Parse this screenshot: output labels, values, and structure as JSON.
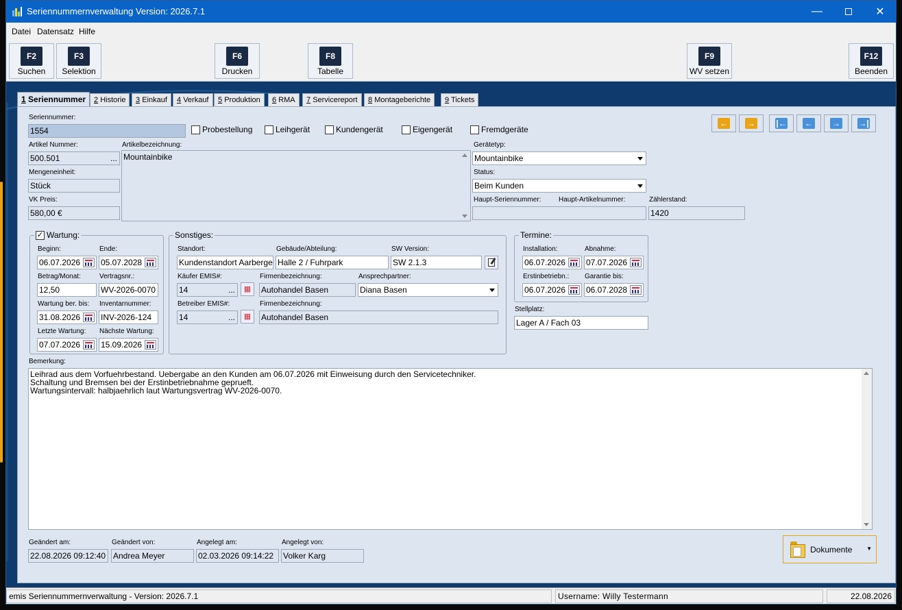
{
  "window": {
    "title": "Seriennummernverwaltung Version: 2026.7.1"
  },
  "menu": {
    "items": [
      "Datei",
      "Datensatz",
      "Hilfe"
    ]
  },
  "toolbar": {
    "f2": {
      "key": "F2",
      "label": "Suchen"
    },
    "f3": {
      "key": "F3",
      "label": "Selektion"
    },
    "f6": {
      "key": "F6",
      "label": "Drucken"
    },
    "f8": {
      "key": "F8",
      "label": "Tabelle"
    },
    "f9": {
      "key": "F9",
      "label": "WV setzen"
    },
    "f12": {
      "key": "F12",
      "label": "Beenden"
    }
  },
  "tabs": [
    {
      "num": "1",
      "label": "Seriennummer"
    },
    {
      "num": "2",
      "label": "Historie"
    },
    {
      "num": "3",
      "label": "Einkauf"
    },
    {
      "num": "4",
      "label": "Verkauf"
    },
    {
      "num": "5",
      "label": "Produktion"
    },
    {
      "num": "6",
      "label": "RMA"
    },
    {
      "num": "7",
      "label": "Servicereport"
    },
    {
      "num": "8",
      "label": "Montageberichte"
    },
    {
      "num": "9",
      "label": "Tickets"
    }
  ],
  "main": {
    "seriennummer": {
      "label": "Seriennummer:",
      "value": "1554"
    },
    "checks": {
      "probestellung": "Probestellung",
      "leihgeraet": "Leihgerät",
      "kundengeraet": "Kundengerät",
      "eigengeraet": "Eigengerät",
      "fremdgeraete": "Fremdgeräte"
    },
    "artikelnummer": {
      "label": "Artikel Nummer:",
      "value": "500.501"
    },
    "artikelbez": {
      "label": "Artikelbezeichnung:",
      "value": "Mountainbike"
    },
    "mengeneinheit": {
      "label": "Mengeneinheit:",
      "value": "Stück"
    },
    "vkpreis": {
      "label": "VK Preis:",
      "value": "580,00 €"
    },
    "geraetetyp": {
      "label": "Gerätetyp:",
      "value": "Mountainbike"
    },
    "status": {
      "label": "Status:",
      "value": "Beim Kunden"
    },
    "hauptsn": {
      "label": "Haupt-Seriennummer:",
      "value": ""
    },
    "hauptart": {
      "label": "Haupt-Artikelnummer:",
      "value": ""
    },
    "zaehler": {
      "label": "Zählerstand:",
      "value": "1420"
    }
  },
  "wartung": {
    "title": "Wartung:",
    "beginn": {
      "label": "Beginn:",
      "value": "06.07.2026"
    },
    "ende": {
      "label": "Ende:",
      "value": "05.07.2028"
    },
    "betrag": {
      "label": "Betrag/Monat:",
      "value": "12,50"
    },
    "vertrag": {
      "label": "Vertragsnr.:",
      "value": "WV-2026-0070"
    },
    "berbis": {
      "label": "Wartung ber. bis:",
      "value": "31.08.2026"
    },
    "inventar": {
      "label": "Inventarnummer:",
      "value": "INV-2026-124"
    },
    "letzte": {
      "label": "Letzte Wartung:",
      "value": "07.07.2026"
    },
    "naechste": {
      "label": "Nächste Wartung:",
      "value": "15.09.2026"
    }
  },
  "sonstiges": {
    "title": "Sonstiges:",
    "standort": {
      "label": "Standort:",
      "value": "Kundenstandort Aarbergen"
    },
    "gebaeude": {
      "label": "Gebäude/Abteilung:",
      "value": "Halle 2 / Fuhrpark"
    },
    "sw": {
      "label": "SW Version:",
      "value": "SW 2.1.3"
    },
    "kaeufer": {
      "label": "Käufer EMIS#:",
      "value": "14"
    },
    "firma1": {
      "label": "Firmenbezeichnung:",
      "value": "Autohandel Basen"
    },
    "ansprech": {
      "label": "Ansprechpartner:",
      "value": "Diana Basen"
    },
    "betreiber": {
      "label": "Betreiber EMIS#:",
      "value": "14"
    },
    "firma2": {
      "label": "Firmenbezeichnung:",
      "value": "Autohandel Basen"
    }
  },
  "termine": {
    "title": "Termine:",
    "installation": {
      "label": "Installation:",
      "value": "06.07.2026"
    },
    "abnahme": {
      "label": "Abnahme:",
      "value": "07.07.2026"
    },
    "erstinbetrieb": {
      "label": "Erstinbetriebn.:",
      "value": "06.07.2026"
    },
    "garantie": {
      "label": "Garantie bis:",
      "value": "06.07.2028"
    }
  },
  "stellplatz": {
    "label": "Stellplatz:",
    "value": "Lager A / Fach 03"
  },
  "bemerkung": {
    "label": "Bemerkung:",
    "value": "Leihrad aus dem Vorfuehrbestand. Uebergabe an den Kunden am 06.07.2026 mit Einweisung durch den Servicetechniker.\nSchaltung und Bremsen bei der Erstinbetriebnahme geprueft.\nWartungsintervall: halbjaehrlich laut Wartungsvertrag WV-2026-0070."
  },
  "footer": {
    "geaendert_am": {
      "label": "Geändert am:",
      "value": "22.08.2026 09:12:40"
    },
    "geaendert_von": {
      "label": "Geändert von:",
      "value": "Andrea Meyer"
    },
    "angelegt_am": {
      "label": "Angelegt am:",
      "value": "02.03.2026 09:14:22"
    },
    "angelegt_von": {
      "label": "Angelegt von:",
      "value": "Volker Karg"
    },
    "dokumente": "Dokumente"
  },
  "statusbar": {
    "app": "emis Seriennummernverwaltung - Version: 2026.7.1",
    "user": "Username: Willy Testermann",
    "date": "22.08.2026"
  },
  "colors": {
    "accent": "#e8a317",
    "nav_blue": "#4a90d9",
    "title_blue": "#0a64c8",
    "panel": "#dde6f0"
  }
}
